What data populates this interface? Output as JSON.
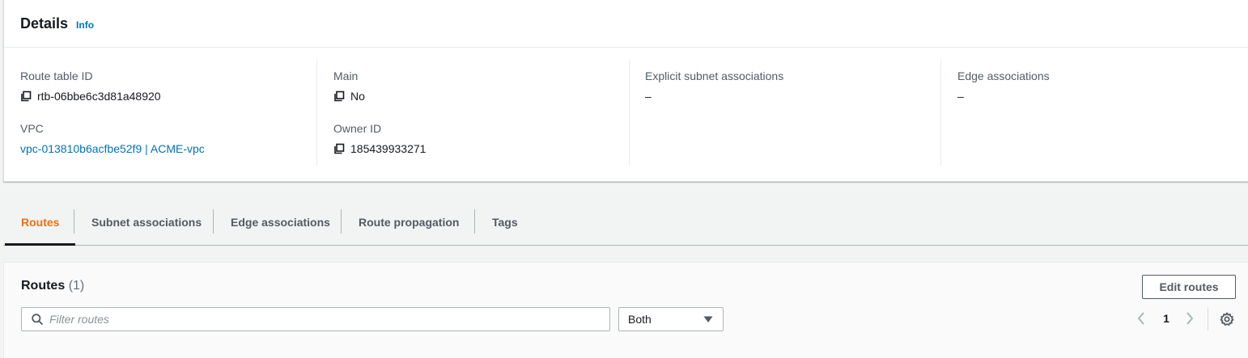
{
  "details": {
    "title": "Details",
    "info_label": "Info",
    "fields": {
      "route_table_id": {
        "label": "Route table ID",
        "value": "rtb-06bbe6c3d81a48920"
      },
      "vpc": {
        "label": "VPC",
        "value": "vpc-013810b6acfbe52f9 | ACME-vpc"
      },
      "main": {
        "label": "Main",
        "value": "No"
      },
      "owner_id": {
        "label": "Owner ID",
        "value": "185439933271"
      },
      "explicit_subnet_associations": {
        "label": "Explicit subnet associations",
        "value": "–"
      },
      "edge_associations": {
        "label": "Edge associations",
        "value": "–"
      }
    }
  },
  "tabs": [
    {
      "label": "Routes",
      "active": true
    },
    {
      "label": "Subnet associations",
      "active": false
    },
    {
      "label": "Edge associations",
      "active": false
    },
    {
      "label": "Route propagation",
      "active": false
    },
    {
      "label": "Tags",
      "active": false
    }
  ],
  "routes": {
    "title": "Routes",
    "count": "(1)",
    "edit_button": "Edit routes",
    "filter_placeholder": "Filter routes",
    "filter_value": "",
    "select_value": "Both",
    "page_number": "1"
  },
  "icons": {
    "copy": "copy-icon",
    "search": "search-icon",
    "caret": "caret-down-icon",
    "prev": "chevron-left-icon",
    "next": "chevron-right-icon",
    "settings": "gear-icon"
  },
  "colors": {
    "link": "#0073bb",
    "active_tab": "#ec7211",
    "text": "#16191f",
    "muted": "#545b64"
  }
}
